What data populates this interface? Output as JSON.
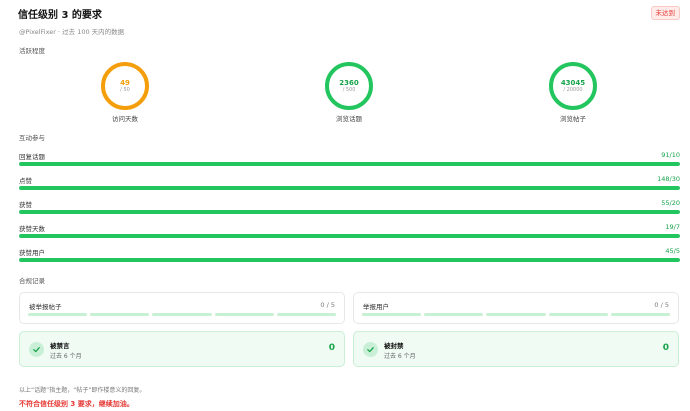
{
  "header": {
    "title": "信任级别 3 的要求",
    "status_badge": "未达到"
  },
  "subtitle": "@PixelFixer · 过去 100 天内的数据",
  "activity": {
    "section_label": "活跃程度",
    "items": [
      {
        "value": "49",
        "required": "/ 50",
        "label": "访问天数",
        "progress": 0.98,
        "color": "#f59e0b"
      },
      {
        "value": "2360",
        "required": "/ 500",
        "label": "浏览话题",
        "progress": 1.0,
        "color": "#22c55e"
      },
      {
        "value": "43045",
        "required": "/ 20000",
        "label": "浏览帖子",
        "progress": 1.0,
        "color": "#22c55e"
      }
    ]
  },
  "interaction": {
    "section_label": "互动参与",
    "items": [
      {
        "label": "回复话题",
        "value": "91/10",
        "progress": 1.0
      },
      {
        "label": "点赞",
        "value": "148/30",
        "progress": 1.0
      },
      {
        "label": "获赞",
        "value": "55/20",
        "progress": 1.0
      },
      {
        "label": "获赞天数",
        "value": "19/7",
        "progress": 1.0
      },
      {
        "label": "获赞用户",
        "value": "45/5",
        "progress": 1.0
      }
    ]
  },
  "compliance": {
    "section_label": "合规记录",
    "flagged_posts": {
      "label": "被举报帖子",
      "value": "0 / 5"
    },
    "flagged_users": {
      "label": "举报用户",
      "value": "0 / 5"
    },
    "silenced": {
      "title": "被禁言",
      "period": "过去 6 个月",
      "value": "0"
    },
    "suspended": {
      "title": "被封禁",
      "period": "过去 6 个月",
      "value": "0"
    }
  },
  "footer": {
    "note": "以上“话题”指主题，“帖子”即作楼意义的回复。",
    "result": "不符合信任级别 3 要求，继续加油。"
  },
  "colors": {
    "success": "#22c55e",
    "warning": "#f59e0b",
    "danger": "#e53935"
  }
}
